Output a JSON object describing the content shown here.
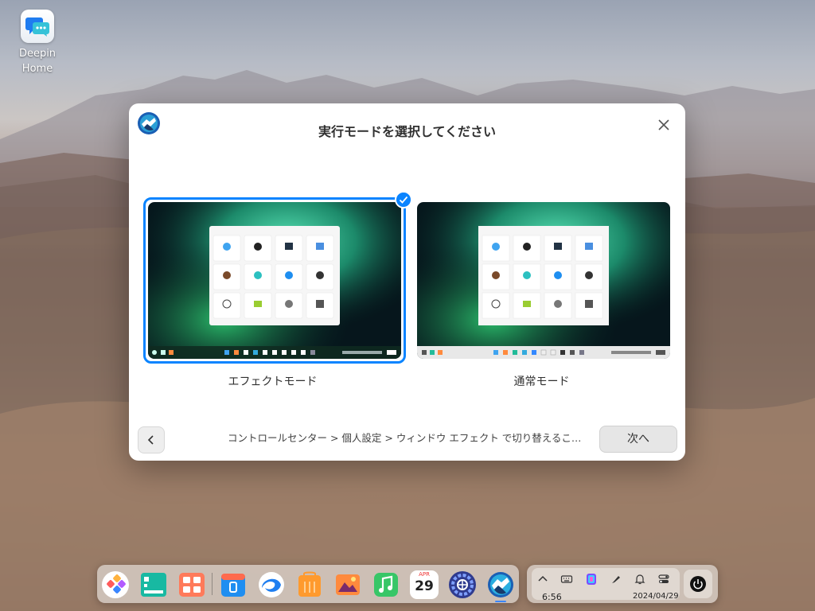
{
  "desktop": {
    "icon_label": "Deepin\nHome",
    "icon_label_line1": "Deepin",
    "icon_label_line2": "Home"
  },
  "dialog": {
    "title": "実行モードを選択してください",
    "modes": [
      {
        "label": "エフェクトモード",
        "selected": true
      },
      {
        "label": "通常モード",
        "selected": false
      }
    ],
    "hint": "コントロールセンター > 個人設定 > ウィンドウ エフェクト で切り替えることがで...",
    "next_label": "次へ",
    "accent": "#0a84ff"
  },
  "dock": {
    "apps": [
      "launcher-icon",
      "deepin-terminal-icon",
      "multitasking-icon",
      "app-store-icon",
      "browser-icon",
      "shop-icon",
      "photos-icon",
      "music-icon",
      "calendar-icon",
      "settings-icon",
      "deepin-home-icon"
    ],
    "calendar_month": "APR",
    "calendar_day": "29"
  },
  "tray": {
    "time": "6:56",
    "date": "2024/04/29"
  }
}
